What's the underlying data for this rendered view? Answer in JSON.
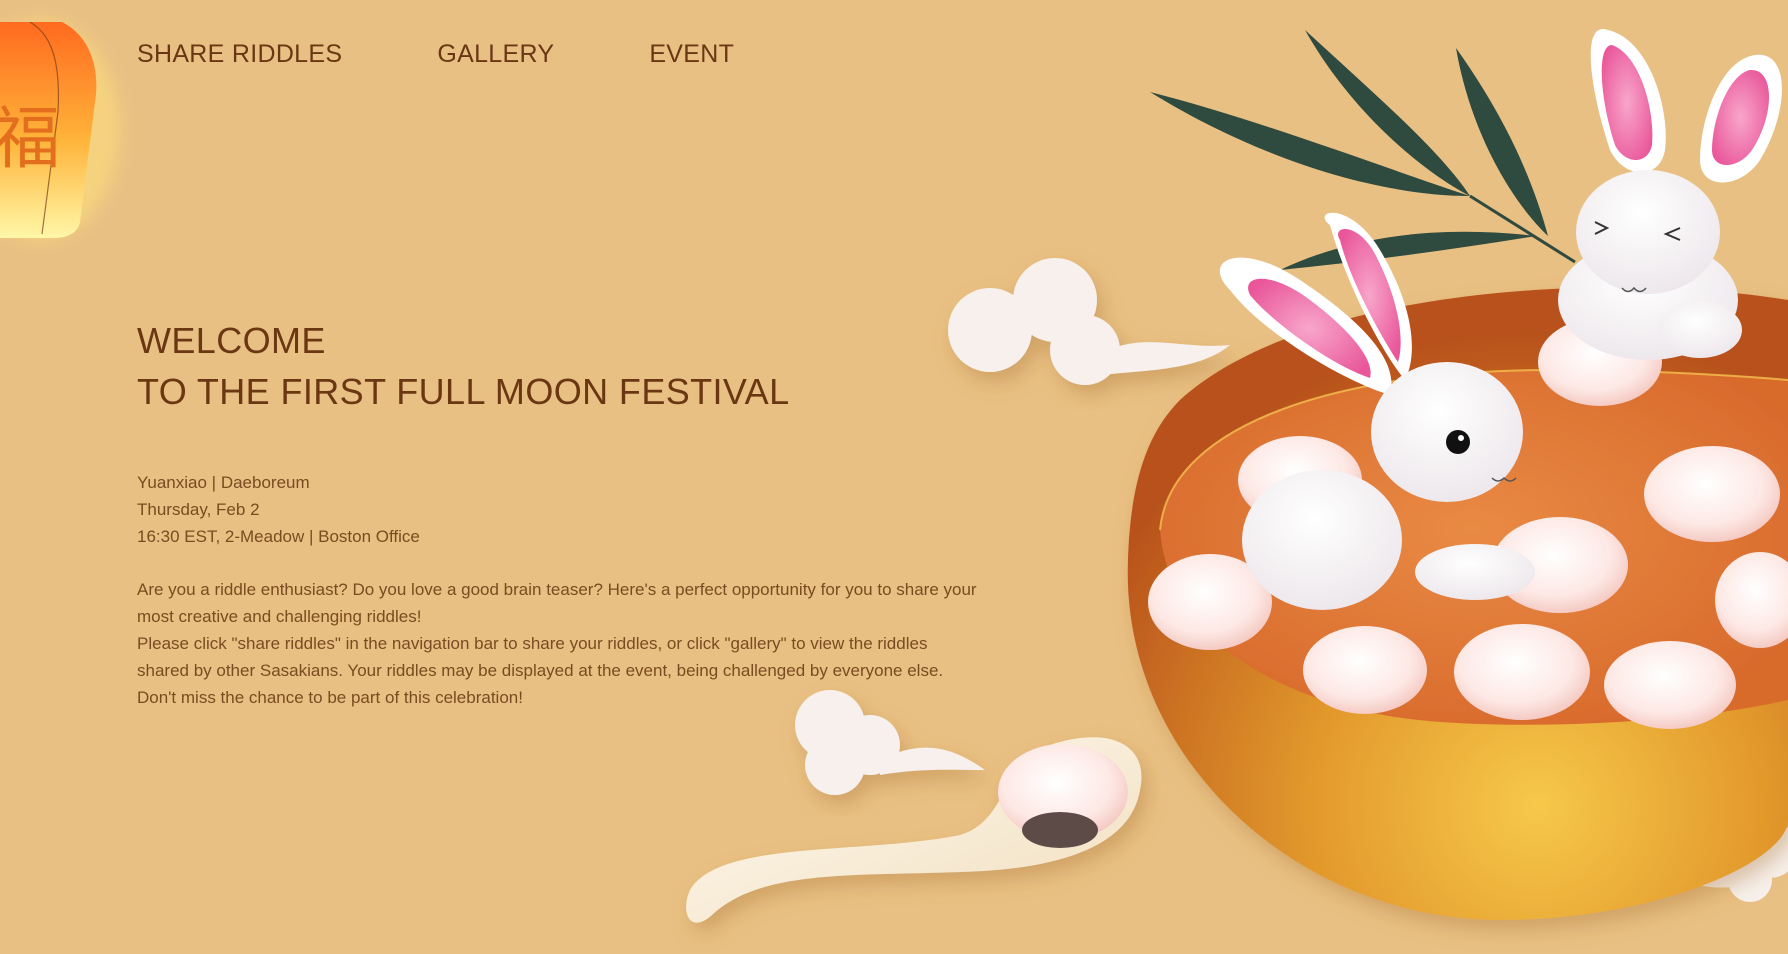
{
  "nav": {
    "items": [
      {
        "label": "SHARE RIDDLES"
      },
      {
        "label": "GALLERY"
      },
      {
        "label": "EVENT"
      }
    ]
  },
  "hero": {
    "title_line1": "WELCOME",
    "title_line2": "TO THE FIRST FULL MOON FESTIVAL",
    "details": [
      "Yuanxiao | Daeboreum",
      "Thursday, Feb 2",
      "16:30 EST, 2-Meadow | Boston Office"
    ],
    "paragraph1": "Are you a riddle enthusiast? Do you love a good brain teaser? Here's a perfect opportunity for you to share your most creative and challenging riddles!",
    "paragraph2": "Please click \"share riddles\" in the navigation bar to share your riddles, or click \"gallery\" to view the riddles shared by other Sasakians. Your riddles may be displayed at the event, being challenged by everyone else. Don't miss the chance to be part of this celebration!"
  },
  "lantern": {
    "glyph": "福"
  },
  "colors": {
    "background": "#e9c084",
    "text": "#6a3712",
    "bowl": "#e08a2a",
    "soup": "#e07b38",
    "tangyuan": "#fbe3df",
    "ear_inner": "#ef7ab0",
    "leaf": "#2f4a3e"
  }
}
